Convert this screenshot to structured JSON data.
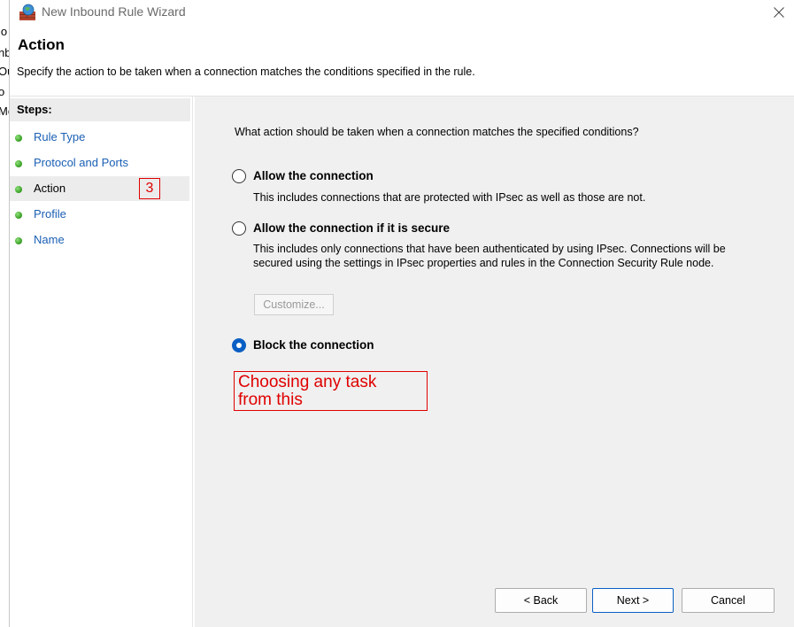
{
  "window": {
    "title": "New Inbound Rule Wizard",
    "icon": "firewall-icon",
    "close_icon": "close-icon"
  },
  "background_window": {
    "fragments": [
      "lo",
      "nb",
      "Ou",
      "o",
      "Mc"
    ]
  },
  "header": {
    "title": "Action",
    "description": "Specify the action to be taken when a connection matches the conditions specified in the rule."
  },
  "steps": {
    "title": "Steps:",
    "items": [
      {
        "label": "Rule Type"
      },
      {
        "label": "Protocol and Ports"
      },
      {
        "label": "Action"
      },
      {
        "label": "Profile"
      },
      {
        "label": "Name"
      }
    ],
    "current": "Action"
  },
  "content": {
    "question": "What action should be taken when a connection matches the specified conditions?",
    "options": [
      {
        "label": "Allow the connection",
        "description": "This includes connections that are protected with IPsec as well as those are not.",
        "selected": false
      },
      {
        "label": "Allow the connection if it is secure",
        "description": "This includes only connections that have been authenticated by using IPsec.  Connections will be secured using the settings in IPsec properties and rules in the Connection Security Rule node.",
        "selected": false
      },
      {
        "label": "Block the connection",
        "selected": true
      }
    ],
    "customize_label": "Customize..."
  },
  "annotations": {
    "step_number": "3",
    "note": "Choosing any task\nfrom this",
    "color": "#e00000"
  },
  "buttons": {
    "back": "< Back",
    "next": "Next >",
    "cancel": "Cancel"
  },
  "colors": {
    "accent": "#0a5fc4",
    "link": "#1a5fb4",
    "step_dot": "#3fa52c"
  }
}
